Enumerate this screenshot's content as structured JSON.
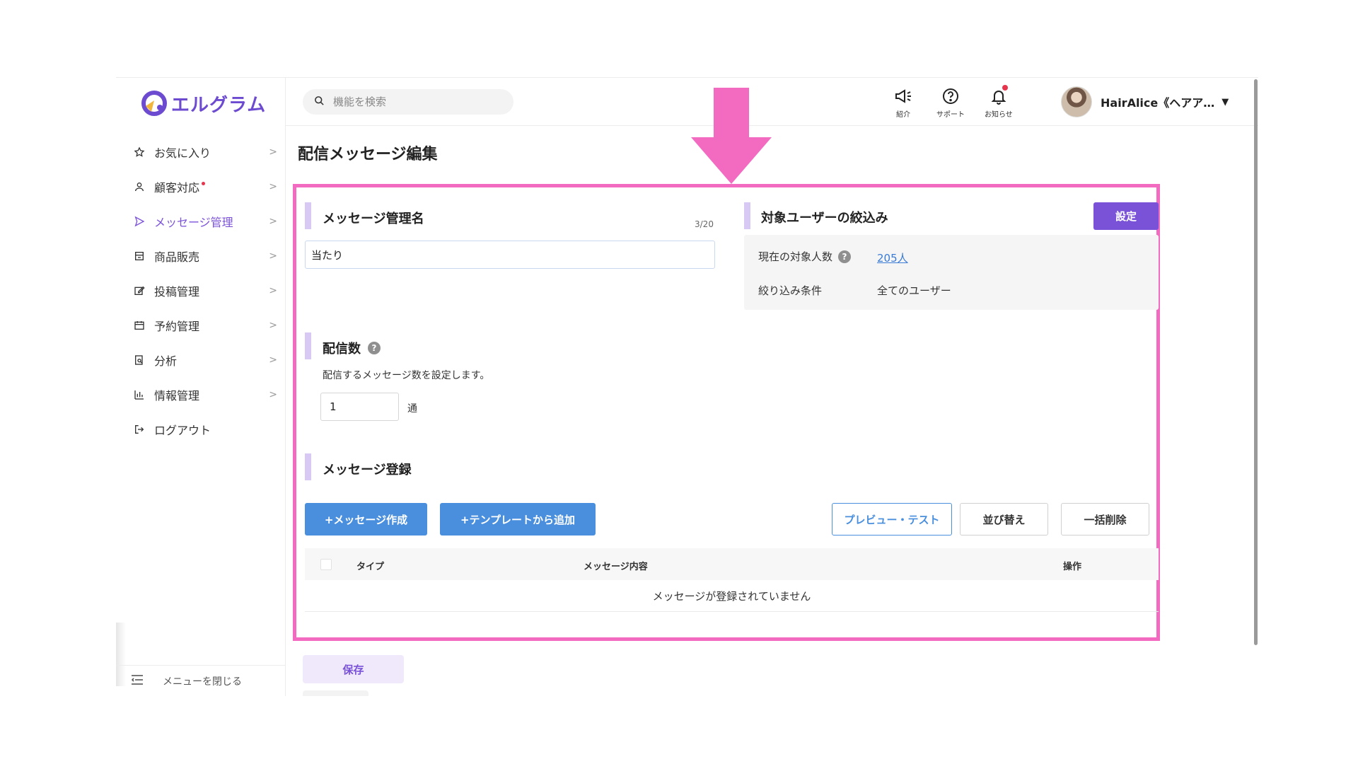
{
  "app": {
    "logo_text": "エルグラム",
    "brand_color": "#6c4bd0"
  },
  "search": {
    "placeholder": "機能を検索"
  },
  "header": {
    "icons": [
      {
        "icon": "megaphone-icon",
        "label": "紹介"
      },
      {
        "icon": "help-circle-icon",
        "label": "サポート"
      },
      {
        "icon": "bell-icon",
        "label": "お知らせ"
      }
    ],
    "user_name": "HairAlice《ヘアア…"
  },
  "sidebar": {
    "items": [
      {
        "icon": "star-icon",
        "label": "お気に入り"
      },
      {
        "icon": "user-icon",
        "label": "顧客対応"
      },
      {
        "icon": "send-icon",
        "label": "メッセージ管理"
      },
      {
        "icon": "store-icon",
        "label": "商品販売"
      },
      {
        "icon": "edit-icon",
        "label": "投稿管理"
      },
      {
        "icon": "calendar-icon",
        "label": "予約管理"
      },
      {
        "icon": "analytics-icon",
        "label": "分析"
      },
      {
        "icon": "chart-icon",
        "label": "情報管理"
      },
      {
        "icon": "logout-icon",
        "label": "ログアウト"
      }
    ],
    "close_menu": "メニューを閉じる"
  },
  "page": {
    "title": "配信メッセージ編集"
  },
  "name_section": {
    "title": "メッセージ管理名",
    "counter": "3/20",
    "value": "当たり"
  },
  "target_section": {
    "title": "対象ユーザーの絞込み",
    "set_button": "設定",
    "count_label": "現在の対象人数",
    "count_value": "205人",
    "condition_label": "絞り込み条件",
    "condition_value": "全てのユーザー"
  },
  "count_section": {
    "title": "配信数",
    "description": "配信するメッセージ数を設定します。",
    "value": "1",
    "unit": "通"
  },
  "register_section": {
    "title": "メッセージ登録",
    "create_button": "+メッセージ作成",
    "template_button": "+テンプレートから追加",
    "preview_button": "プレビュー・テスト",
    "sort_button": "並び替え",
    "bulk_delete_button": "一括削除",
    "table": {
      "columns": [
        "タイプ",
        "メッセージ内容",
        "操作"
      ],
      "empty_text": "メッセージが登録されていません"
    }
  },
  "footer": {
    "save_button": "保存"
  },
  "colors": {
    "highlight": "#f26bc1",
    "accent": "#7a52d8",
    "button_blue": "#4a8fdd"
  }
}
